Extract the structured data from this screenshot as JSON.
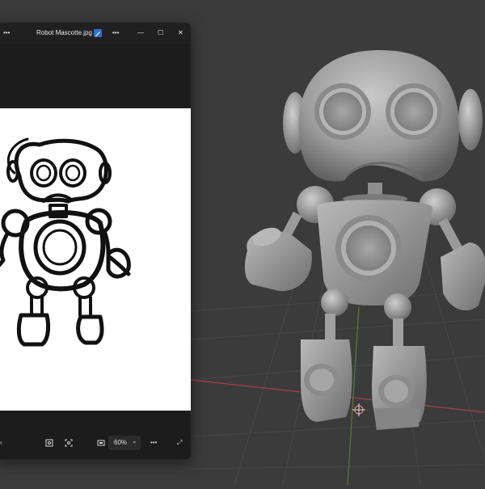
{
  "window": {
    "title": "Robot Mascotte.jpg",
    "more_icon": "more-icon",
    "minimize_icon": "minimize-icon",
    "maximize_icon": "maximize-icon",
    "close_icon": "close-icon",
    "edit_icon": "edit-icon",
    "overflow_glyph": "•••",
    "minimize_glyph": "—",
    "maximize_glyph": "☐",
    "close_glyph": "✕"
  },
  "bottom_bar": {
    "zoom": "60%",
    "icons": [
      "fit-icon",
      "crop-icon",
      "fullscreen-icon",
      "expand-icon"
    ],
    "chevron_glyph": "⌄",
    "more_glyph": "•••",
    "expand_glyph": "⤢"
  },
  "colors": {
    "viewport_bg": "#3b3b3b",
    "window_bg": "#1f1f1f",
    "canvas_bg": "#ffffff",
    "grid_red_axis": "#a8414b",
    "grid_green_axis": "#5c7a2e",
    "model_gray": "#9a9a9a"
  }
}
